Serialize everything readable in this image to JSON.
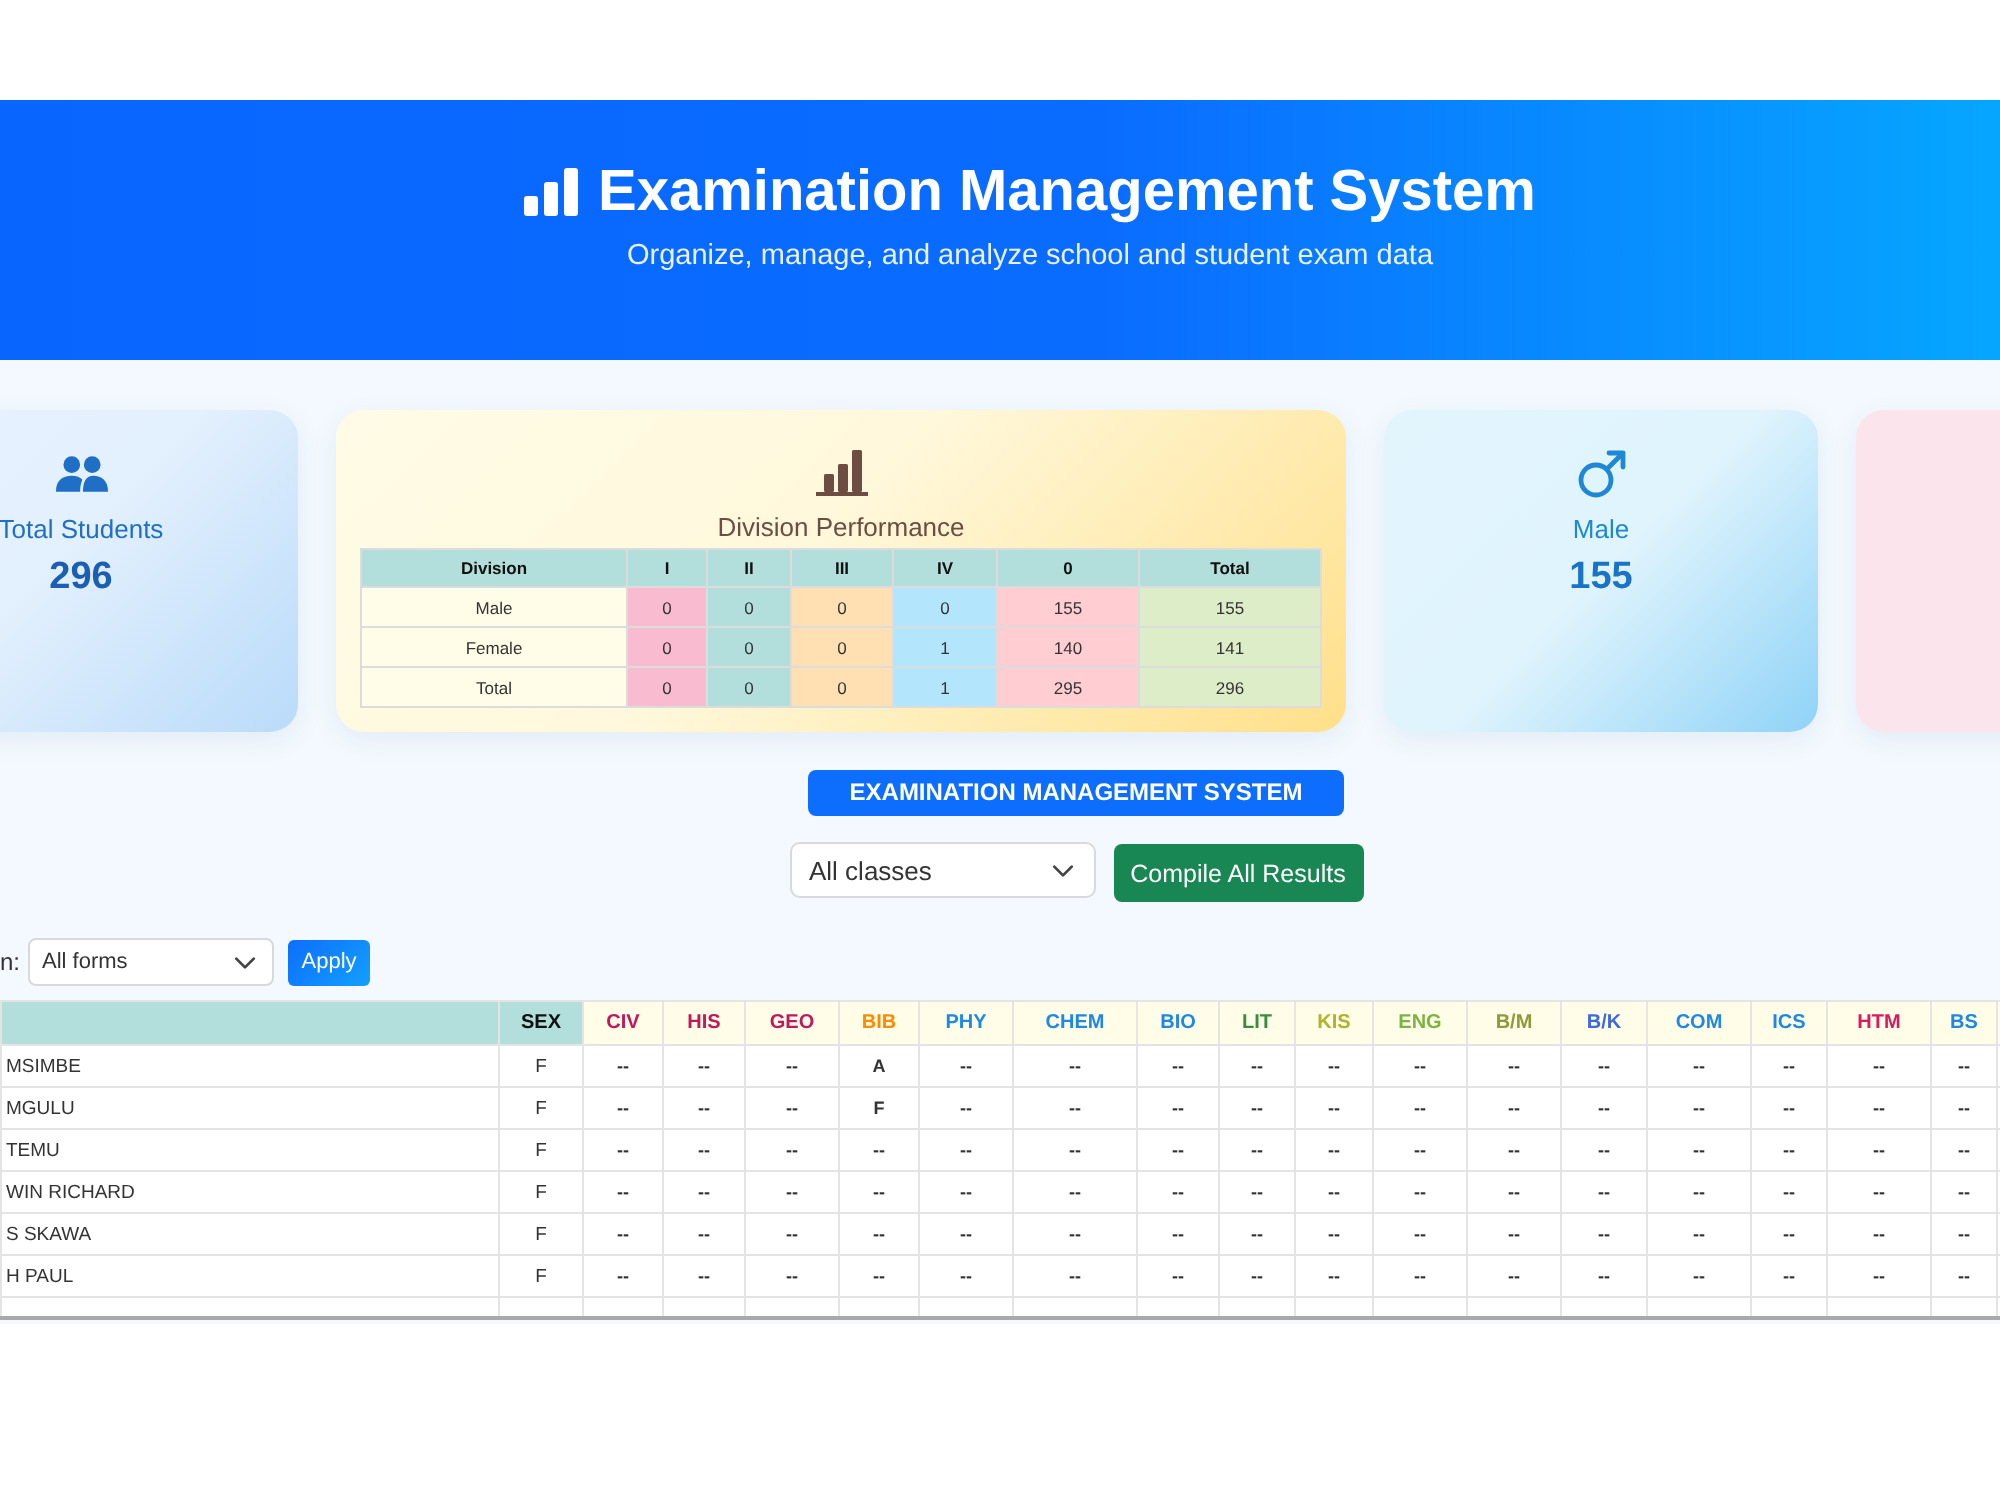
{
  "header": {
    "title": "Examination Management System",
    "subtitle": "Organize, manage, and analyze school and student exam data"
  },
  "cards": [
    {
      "kind": "students",
      "label": "Total Students",
      "value": "296"
    },
    {
      "kind": "division",
      "title": "Division Performance",
      "table": {
        "columns": [
          {
            "label": "Division",
            "color": "#fffde7"
          },
          {
            "label": "I",
            "color": "#f8bbd0"
          },
          {
            "label": "II",
            "color": "#b2dfdb"
          },
          {
            "label": "III",
            "color": "#ffe0b2"
          },
          {
            "label": "IV",
            "color": "#b3e5fc"
          },
          {
            "label": "0",
            "color": "#ffcdd2"
          },
          {
            "label": "Total",
            "color": "#dcedc8"
          }
        ],
        "rows": [
          [
            "Male",
            "0",
            "0",
            "0",
            "0",
            "155",
            "155"
          ],
          [
            "Female",
            "0",
            "0",
            "0",
            "1",
            "140",
            "141"
          ],
          [
            "Total",
            "0",
            "0",
            "0",
            "1",
            "295",
            "296"
          ]
        ]
      }
    },
    {
      "kind": "male",
      "label": "Male",
      "value": "155"
    },
    {
      "kind": "cutoff"
    }
  ],
  "banner": "EXAMINATION MANAGEMENT SYSTEM",
  "class_select": {
    "value": "All classes"
  },
  "compile_button": "Compile All Results",
  "form_filter": {
    "label": "n:",
    "value": "All forms",
    "button": "Apply"
  },
  "results_table": {
    "sex_header": "SEX",
    "subjects": [
      {
        "label": "CIV",
        "color": "#c2185b"
      },
      {
        "label": "HIS",
        "color": "#c2185b"
      },
      {
        "label": "GEO",
        "color": "#c2185b"
      },
      {
        "label": "BIB",
        "color": "#fb8c00"
      },
      {
        "label": "PHY",
        "color": "#1e88e5"
      },
      {
        "label": "CHEM",
        "color": "#1e88e5"
      },
      {
        "label": "BIO",
        "color": "#1e88e5"
      },
      {
        "label": "LIT",
        "color": "#388e3c"
      },
      {
        "label": "KIS",
        "color": "#afb42b"
      },
      {
        "label": "ENG",
        "color": "#7cb342"
      },
      {
        "label": "B/M",
        "color": "#8d9b3a"
      },
      {
        "label": "B/K",
        "color": "#3f6ad8"
      },
      {
        "label": "COM",
        "color": "#1e88e5"
      },
      {
        "label": "ICS",
        "color": "#1e88e5"
      },
      {
        "label": "HTM",
        "color": "#d81b60"
      },
      {
        "label": "BS",
        "color": "#1e88e5"
      }
    ],
    "rows": [
      {
        "name": "MSIMBE",
        "sex": "F",
        "grades": [
          "--",
          "--",
          "--",
          "A",
          "--",
          "--",
          "--",
          "--",
          "--",
          "--",
          "--",
          "--",
          "--",
          "--",
          "--",
          "--"
        ]
      },
      {
        "name": "MGULU",
        "sex": "F",
        "grades": [
          "--",
          "--",
          "--",
          "F",
          "--",
          "--",
          "--",
          "--",
          "--",
          "--",
          "--",
          "--",
          "--",
          "--",
          "--",
          "--"
        ]
      },
      {
        "name": "TEMU",
        "sex": "F",
        "grades": [
          "--",
          "--",
          "--",
          "--",
          "--",
          "--",
          "--",
          "--",
          "--",
          "--",
          "--",
          "--",
          "--",
          "--",
          "--",
          "--"
        ]
      },
      {
        "name": "WIN RICHARD",
        "sex": "F",
        "grades": [
          "--",
          "--",
          "--",
          "--",
          "--",
          "--",
          "--",
          "--",
          "--",
          "--",
          "--",
          "--",
          "--",
          "--",
          "--",
          "--"
        ]
      },
      {
        "name": "S SKAWA",
        "sex": "F",
        "grades": [
          "--",
          "--",
          "--",
          "--",
          "--",
          "--",
          "--",
          "--",
          "--",
          "--",
          "--",
          "--",
          "--",
          "--",
          "--",
          "--"
        ]
      },
      {
        "name": "H PAUL",
        "sex": "F",
        "grades": [
          "--",
          "--",
          "--",
          "--",
          "--",
          "--",
          "--",
          "--",
          "--",
          "--",
          "--",
          "--",
          "--",
          "--",
          "--",
          "--"
        ]
      }
    ]
  }
}
